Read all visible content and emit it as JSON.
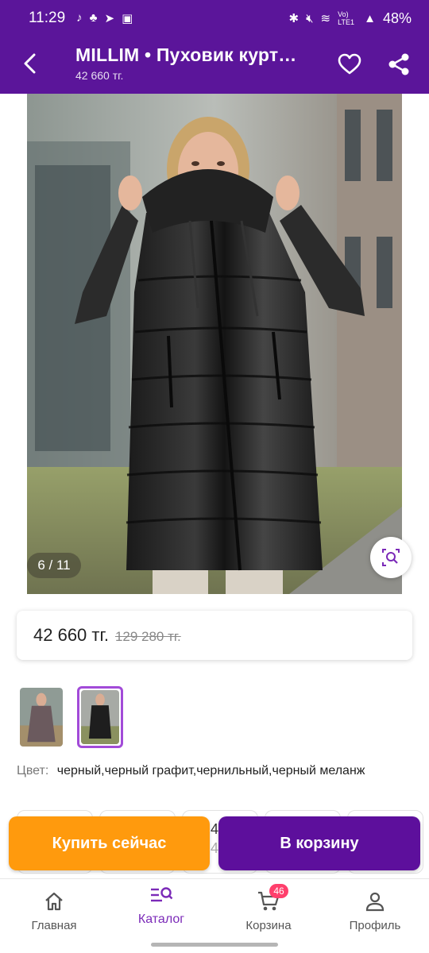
{
  "status_bar": {
    "time": "11:29",
    "battery": "48%",
    "network": "Vo) LTE1"
  },
  "header": {
    "title": "MILLIM • Пуховик курт…",
    "subtitle": "42 660 тг."
  },
  "gallery": {
    "counter": "6 / 11"
  },
  "price": {
    "current": "42 660 тг.",
    "old": "129 280 тг."
  },
  "color": {
    "label": "Цвет:",
    "value": "черный,черный графит,чернильный,черный меланж"
  },
  "sizes_peek": {
    "top": "4",
    "bottom": "4"
  },
  "actions": {
    "buy_now": "Купить сейчас",
    "add_to_cart": "В корзину"
  },
  "bottom_nav": {
    "items": [
      {
        "label": "Главная",
        "icon": "home-icon"
      },
      {
        "label": "Каталог",
        "icon": "catalog-search-icon",
        "active": true
      },
      {
        "label": "Корзина",
        "icon": "cart-icon",
        "badge": "46"
      },
      {
        "label": "Профиль",
        "icon": "profile-icon"
      }
    ]
  },
  "colors": {
    "brand_purple": "#5b159a",
    "buy_now_orange": "#ff9a0d",
    "cart_purple": "#5d0f9c",
    "badge_pink": "#ff3f6c",
    "active_nav": "#7b2ab8"
  }
}
